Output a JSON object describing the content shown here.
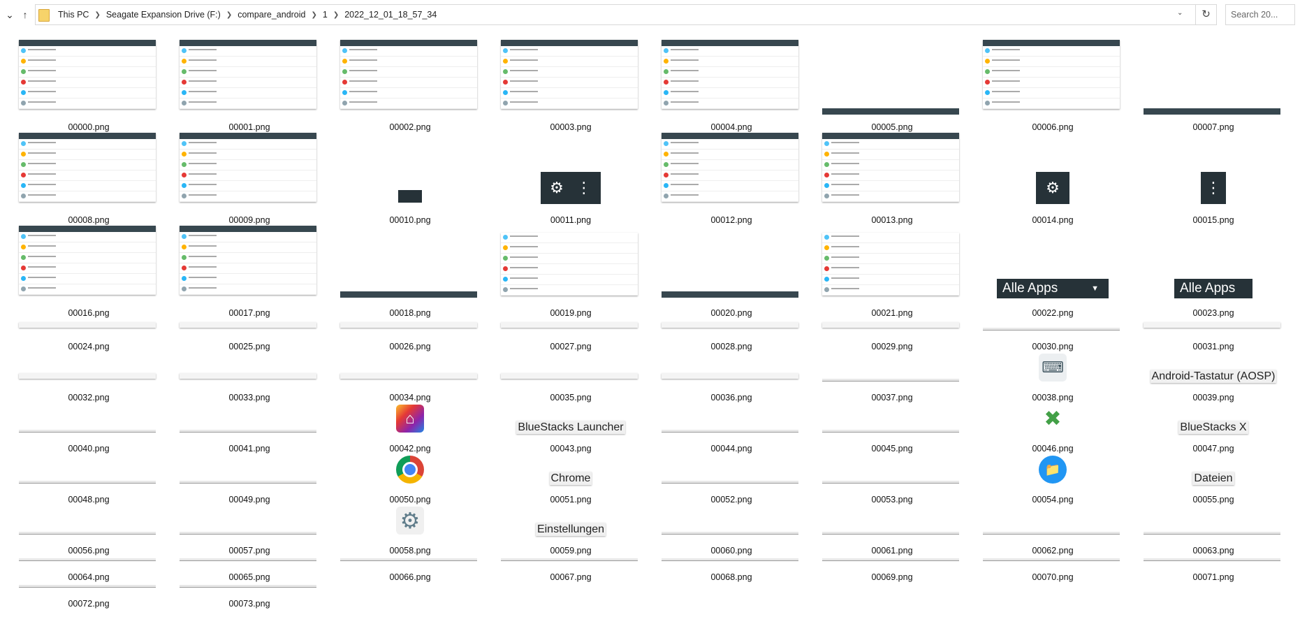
{
  "window": {
    "breadcrumb": [
      "This PC",
      "Seagate Expansion Drive (F:)",
      "compare_android",
      "1",
      "2022_12_01_18_57_34"
    ],
    "search_placeholder": "Search 20..."
  },
  "thumb_text": {
    "apps": "Apps",
    "alle_apps": "Alle Apps",
    "tastatur": "Android-Tastatur (AOSP)",
    "launcher": "BlueStacks Launcher",
    "bsx": "BlueStacks X",
    "chrome": "Chrome",
    "dateien": "Dateien",
    "einstellungen": "Einstellungen"
  },
  "files": [
    "00000.png",
    "00001.png",
    "00002.png",
    "00003.png",
    "00004.png",
    "00005.png",
    "00006.png",
    "00007.png",
    "00008.png",
    "00009.png",
    "00010.png",
    "00011.png",
    "00012.png",
    "00013.png",
    "00014.png",
    "00015.png",
    "00016.png",
    "00017.png",
    "00018.png",
    "00019.png",
    "00020.png",
    "00021.png",
    "00022.png",
    "00023.png",
    "00024.png",
    "00025.png",
    "00026.png",
    "00027.png",
    "00028.png",
    "00029.png",
    "00030.png",
    "00031.png",
    "00032.png",
    "00033.png",
    "00034.png",
    "00035.png",
    "00036.png",
    "00037.png",
    "00038.png",
    "00039.png",
    "00040.png",
    "00041.png",
    "00042.png",
    "00043.png",
    "00044.png",
    "00045.png",
    "00046.png",
    "00047.png",
    "00048.png",
    "00049.png",
    "00050.png",
    "00051.png",
    "00052.png",
    "00053.png",
    "00054.png",
    "00055.png",
    "00056.png",
    "00057.png",
    "00058.png",
    "00059.png",
    "00060.png",
    "00061.png",
    "00062.png",
    "00063.png",
    "00064.png",
    "00065.png",
    "00066.png",
    "00067.png",
    "00068.png",
    "00069.png",
    "00070.png",
    "00071.png",
    "00072.png",
    "00073.png"
  ]
}
